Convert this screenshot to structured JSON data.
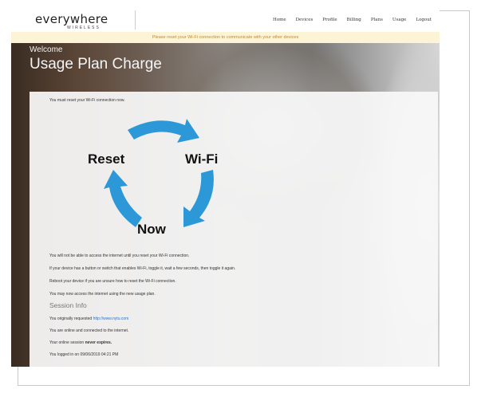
{
  "logo": {
    "main": "everywhere",
    "sub": "WIRELESS"
  },
  "nav": [
    "Home",
    "Devices",
    "Profile",
    "Billing",
    "Plans",
    "Usage",
    "Logout"
  ],
  "banner": "Please reset your Wi-Fi connection to communicate with your other devices",
  "welcome": "Welcome",
  "page_title": "Usage Plan Charge",
  "intro": "You must reset your Wi-Fi connection now.",
  "diagram": {
    "reset": "Reset",
    "wifi": "Wi-Fi",
    "now": "Now",
    "arrow_color": "#2c98d8"
  },
  "instructions": [
    "You will not be able to access the internet until you reset your Wi-Fi connection.",
    "If your device has a button or switch that enables Wi-Fi, toggle it, wait a few seconds, then toggle it again.",
    "Reboot your device if you are unsure how to reset the Wi-Fi connection.",
    "You may now access the internet using the new usage plan."
  ],
  "session": {
    "heading": "Session Info",
    "requested_prefix": "You originally requested",
    "requested_url": "http://www.nytu.com",
    "online": "You are online and connected to the internet.",
    "expires_prefix": "Your online session",
    "expires_bold": "never expires.",
    "logged_in": "You logged in on 09/06/2019 04:21 PM"
  }
}
